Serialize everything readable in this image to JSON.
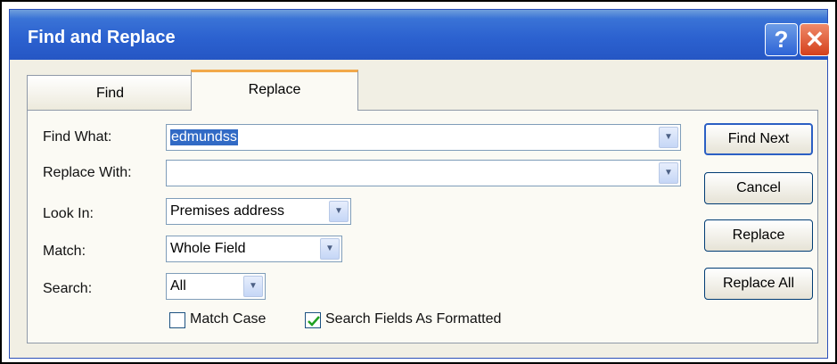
{
  "window": {
    "title": "Find and Replace",
    "help_icon": "?",
    "close_icon": "✕"
  },
  "tabs": [
    {
      "label": "Find",
      "active": false
    },
    {
      "label": "Replace",
      "active": true
    }
  ],
  "form": {
    "find_what": {
      "label": "Find What:",
      "value": "edmundss",
      "selected": true
    },
    "replace_with": {
      "label": "Replace With:",
      "value": ""
    },
    "look_in": {
      "label": "Look In:",
      "value": "Premises address"
    },
    "match": {
      "label": "Match:",
      "value": "Whole Field"
    },
    "search": {
      "label": "Search:",
      "value": "All"
    },
    "match_case": {
      "label": "Match Case",
      "checked": false
    },
    "search_fields_as_formatted": {
      "label": "Search Fields As Formatted",
      "checked": true
    }
  },
  "buttons": {
    "find_next": "Find Next",
    "cancel": "Cancel",
    "replace": "Replace",
    "replace_all": "Replace All"
  },
  "colors": {
    "titlebar": "#2c62d0",
    "active_tab_accent": "#f2a94a",
    "close_button": "#d4401b",
    "selection": "#316ac5"
  }
}
